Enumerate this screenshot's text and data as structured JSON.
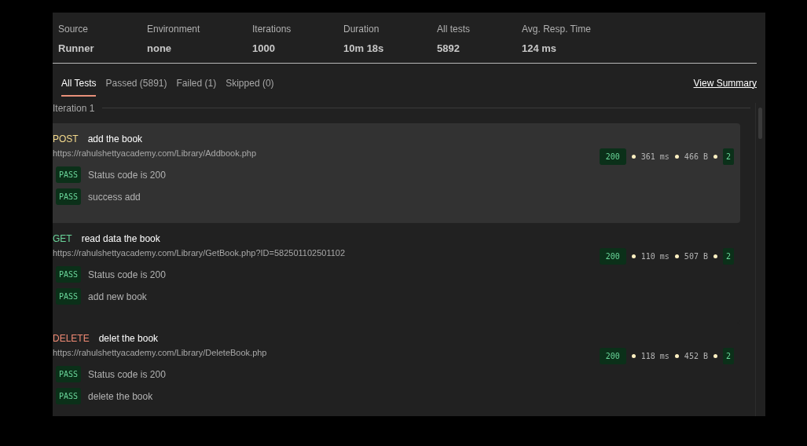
{
  "summary": {
    "stats": [
      {
        "label": "Source",
        "value": "Runner"
      },
      {
        "label": "Environment",
        "value": "none"
      },
      {
        "label": "Iterations",
        "value": "1000"
      },
      {
        "label": "Duration",
        "value": "10m 18s"
      },
      {
        "label": "All tests",
        "value": "5892"
      },
      {
        "label": "Avg. Resp. Time",
        "value": "124 ms"
      }
    ]
  },
  "tabs": [
    {
      "label": "All Tests",
      "selected": true
    },
    {
      "label": "Passed (5891)",
      "selected": false
    },
    {
      "label": "Failed (1)",
      "selected": false
    },
    {
      "label": "Skipped (0)",
      "selected": false
    }
  ],
  "view_summary": "View Summary",
  "iteration": "Iteration 1",
  "requests": [
    {
      "kind": "post",
      "method": "POST",
      "name": "add the book",
      "url": "https://rahulshettyacademy.com/Library/Addbook.php",
      "hovered": true,
      "status": "200",
      "time": "361 ms",
      "size": "466 B",
      "count": "2",
      "tests": [
        {
          "result": "PASS",
          "name": "Status code is 200"
        },
        {
          "result": "PASS",
          "name": "success add"
        }
      ]
    },
    {
      "kind": "get",
      "method": "GET",
      "name": "read data the book",
      "url": "https://rahulshettyacademy.com/Library/GetBook.php?ID=582501102501102",
      "hovered": false,
      "status": "200",
      "time": "110 ms",
      "size": "507 B",
      "count": "2",
      "tests": [
        {
          "result": "PASS",
          "name": "Status code is 200"
        },
        {
          "result": "PASS",
          "name": "add new book"
        }
      ]
    },
    {
      "kind": "delete",
      "method": "DELETE",
      "name": "delet the book",
      "url": "https://rahulshettyacademy.com/Library/DeleteBook.php",
      "hovered": false,
      "status": "200",
      "time": "118 ms",
      "size": "452 B",
      "count": "2",
      "tests": [
        {
          "result": "PASS",
          "name": "Status code is 200"
        },
        {
          "result": "PASS",
          "name": "delete the book"
        }
      ]
    }
  ]
}
